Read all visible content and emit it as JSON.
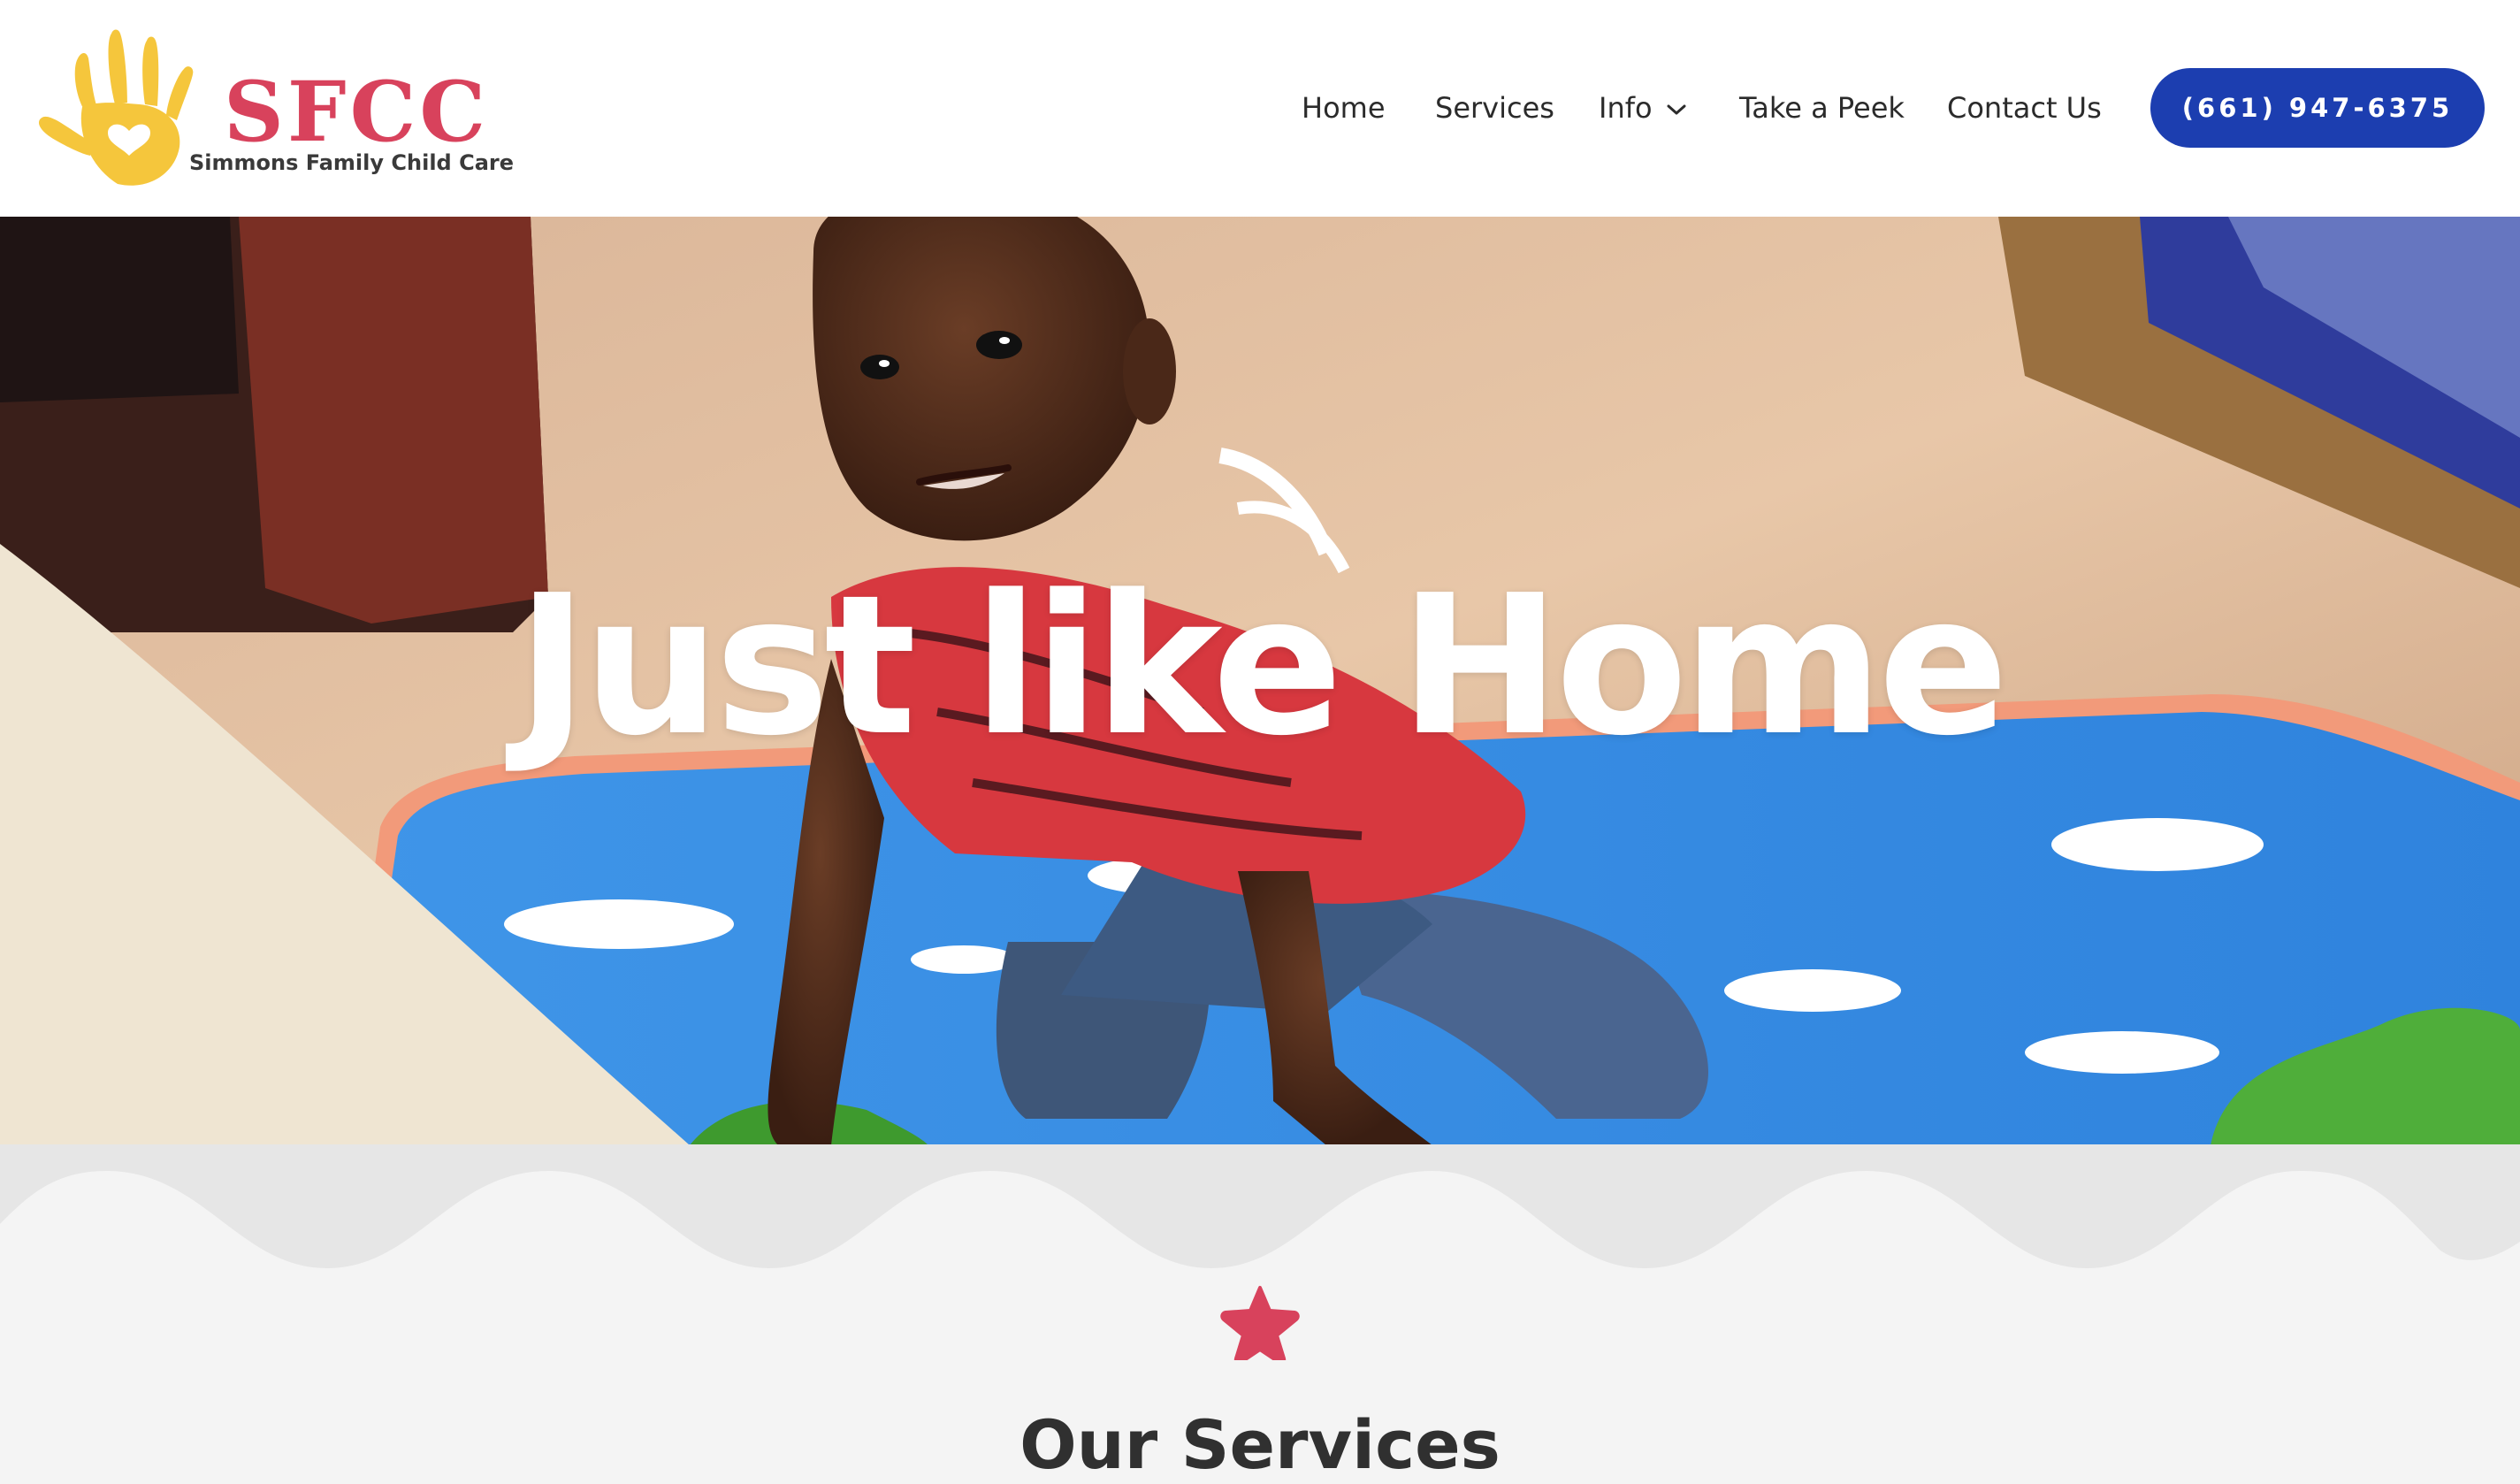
{
  "header": {
    "logo": {
      "text": "SFCC",
      "subtitle": "Simmons Family Child Care"
    },
    "nav": [
      {
        "label": "Home"
      },
      {
        "label": "Services"
      },
      {
        "label": "Info",
        "has_dropdown": true,
        "icon": "chevron-down-icon"
      },
      {
        "label": "Take a Peek"
      },
      {
        "label": "Contact Us"
      }
    ],
    "phone_button": "(661) 947-6375"
  },
  "hero": {
    "title": "Just like Home"
  },
  "services": {
    "icon": "star-icon",
    "heading": "Our Services"
  },
  "colors": {
    "brand_pink": "#d8425c",
    "brand_yellow": "#f5c63c",
    "button_blue": "#1c3eb0",
    "wave_gray": "#e6e6e6",
    "section_bg": "#f4f4f4"
  }
}
